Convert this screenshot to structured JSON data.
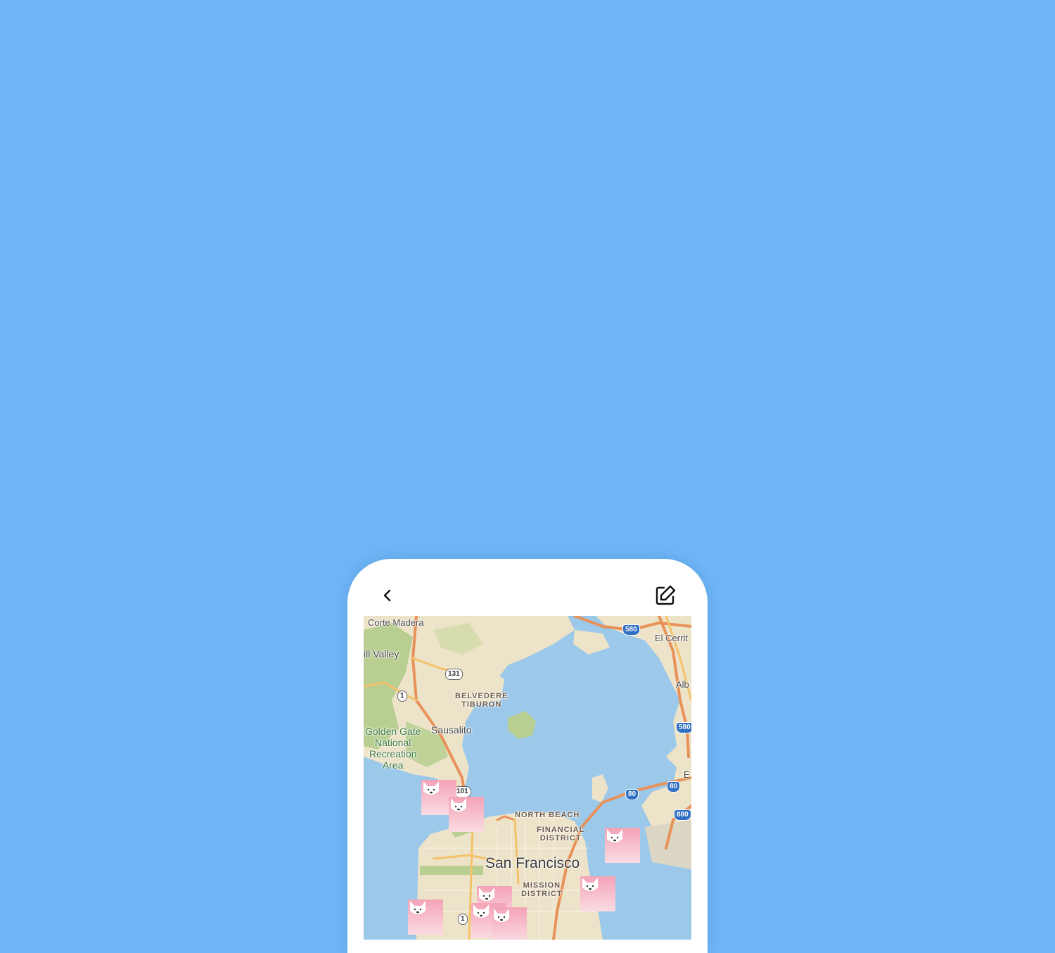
{
  "colors": {
    "background": "#6fb6f7",
    "phone": "#ffffff",
    "water": "#9cc8ea",
    "land": "#ede3c8",
    "park": "#b9cf92",
    "highway": "#e8925a",
    "marker_top": "#f4a3b7",
    "marker_bottom": "#fadbe2"
  },
  "toolbar": {
    "back_icon": "chevron-left-icon",
    "edit_icon": "pencil-square-icon"
  },
  "map": {
    "labels": {
      "corte_madera": "Corte Madera",
      "mill_valley": "ill Valley",
      "el_cerrito": "El Cerrit",
      "albany": "Alb",
      "belvedere": "BELVEDERE",
      "tiburon": "TIBURON",
      "golden_gate_1": "Golden Gate",
      "golden_gate_2": "National",
      "golden_gate_3": "Recreation",
      "golden_gate_4": "Area",
      "sausalito": "Sausalito",
      "north_beach": "NORTH BEACH",
      "financial_1": "FINANCIAL",
      "financial_2": "DISTRICT",
      "san_francisco": "San Francisco",
      "mission_1": "MISSION",
      "mission_2": "DISTRICT",
      "emeryville": "E"
    },
    "shields": {
      "r131": "131",
      "r1a": "1",
      "r580a": "580",
      "r580b": "580",
      "r101": "101",
      "r80a": "80",
      "r80b": "80",
      "r880": "880",
      "r1b": "1"
    },
    "markers": [
      "dog-marker",
      "dog-marker",
      "dog-marker",
      "dog-marker",
      "dog-marker",
      "dog-marker",
      "dog-marker",
      "dog-marker"
    ]
  }
}
